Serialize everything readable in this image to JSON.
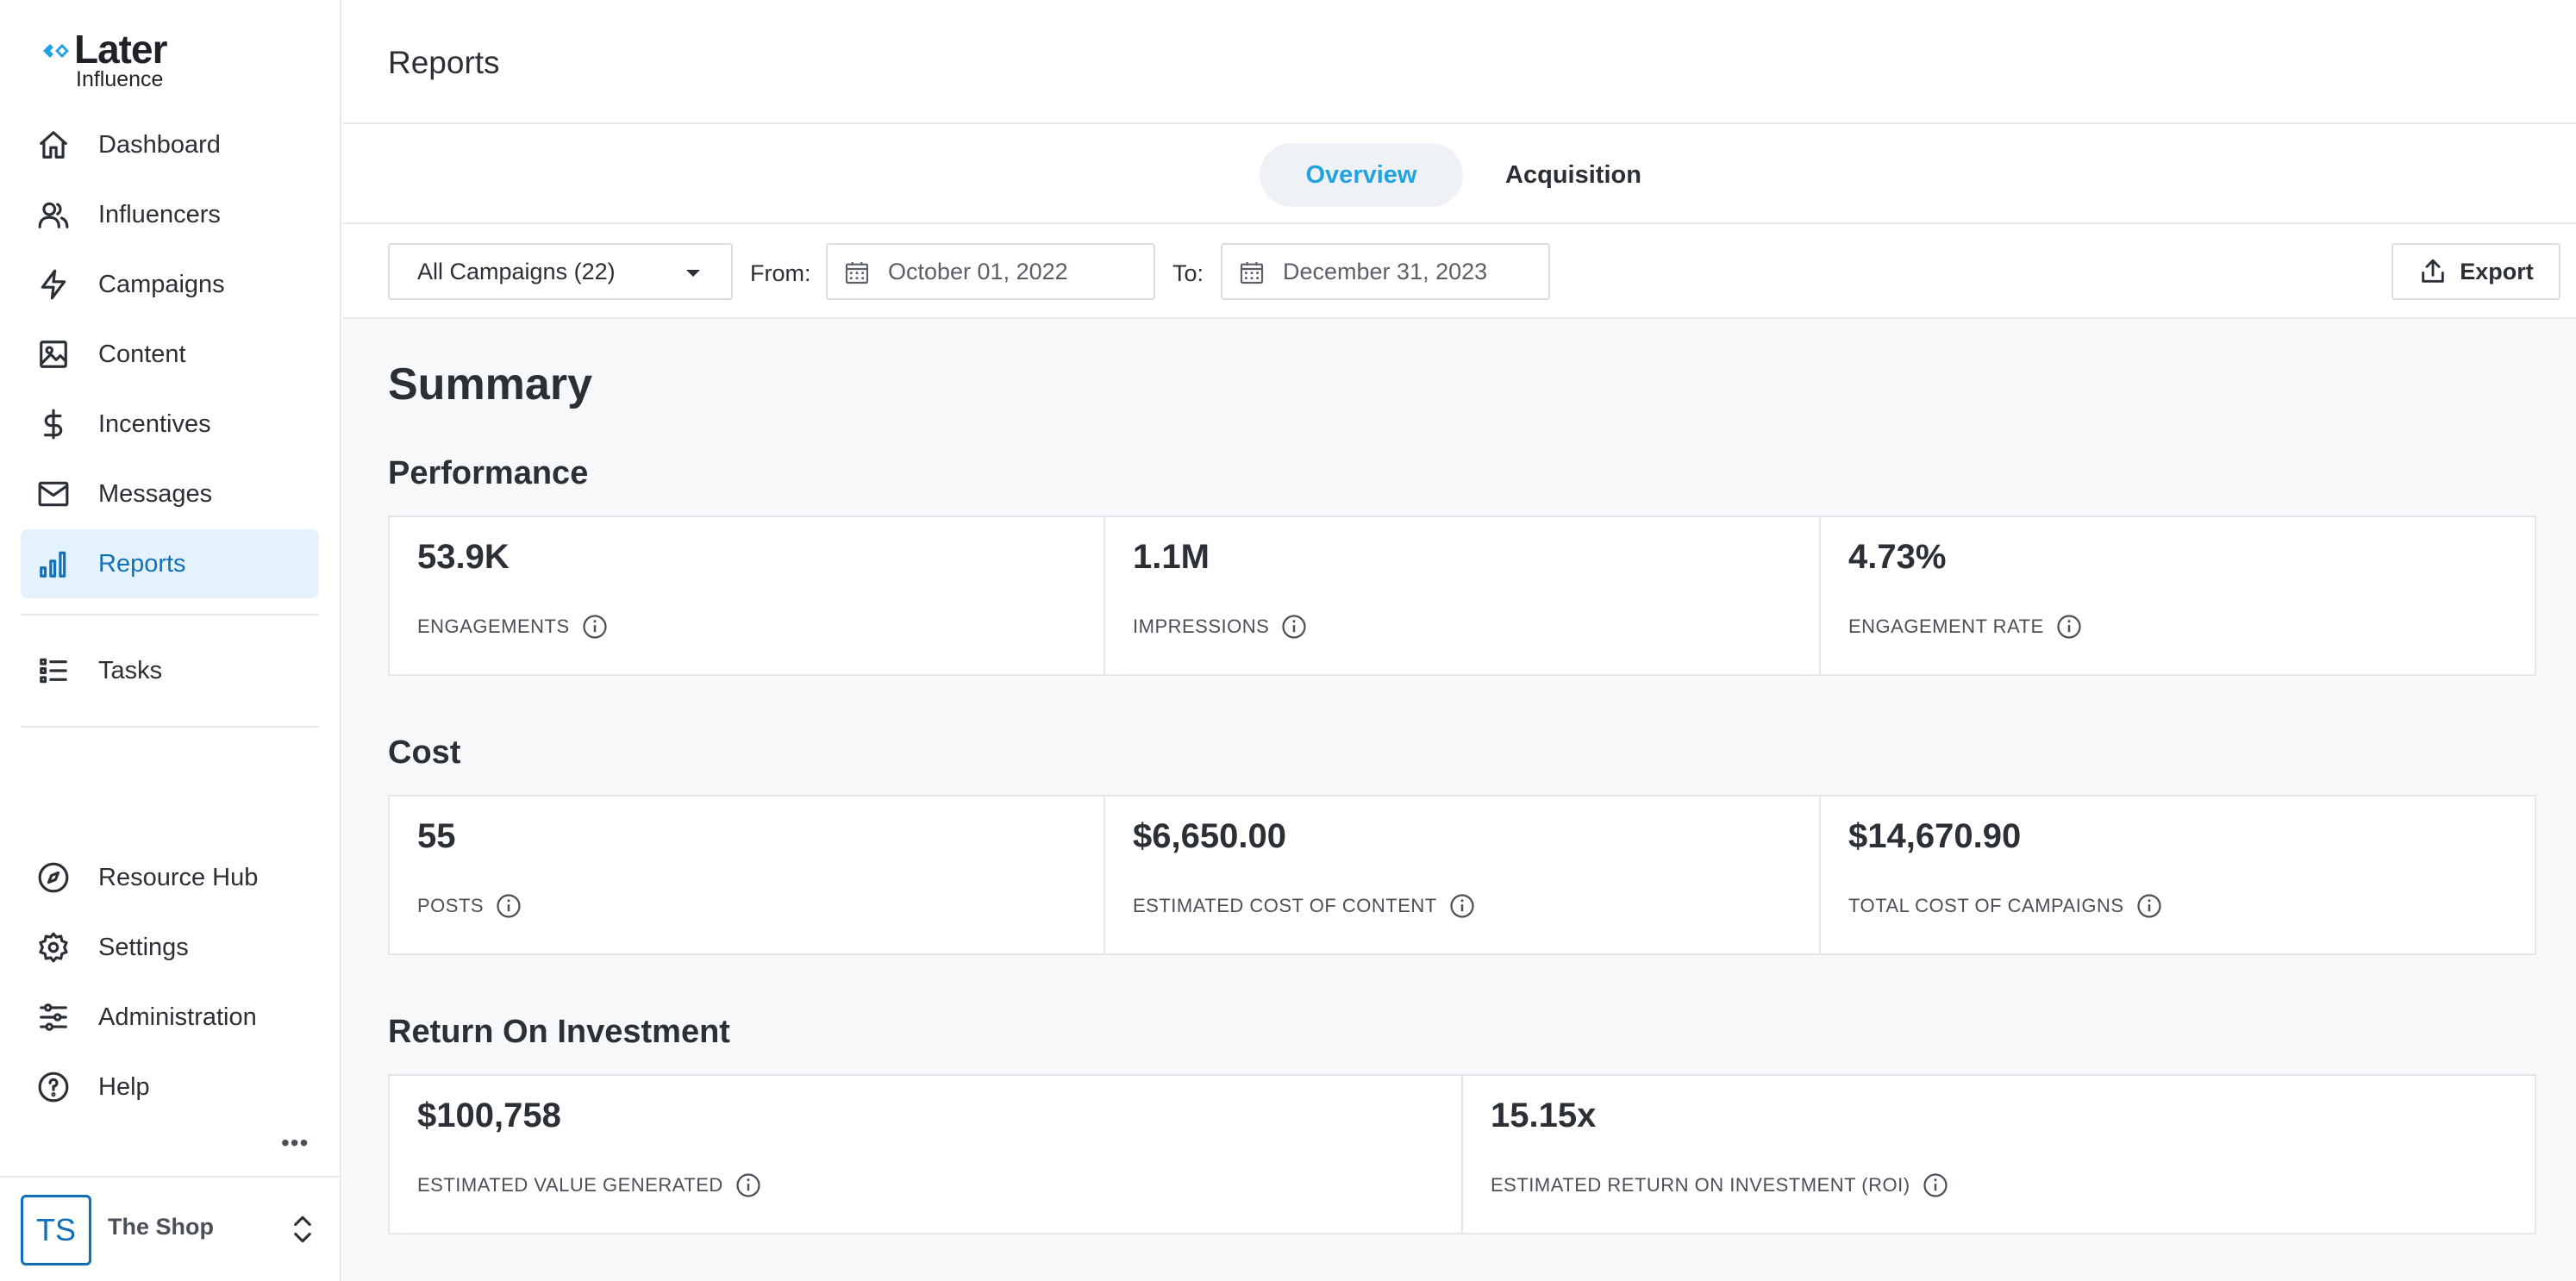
{
  "brand": {
    "name": "Later",
    "sub": "Influence",
    "accent": "#1270b8",
    "mark_color": "#23a2e0"
  },
  "nav": {
    "items": [
      {
        "label": "Dashboard",
        "icon": "home-icon"
      },
      {
        "label": "Influencers",
        "icon": "users-icon"
      },
      {
        "label": "Campaigns",
        "icon": "lightning-icon"
      },
      {
        "label": "Content",
        "icon": "image-icon"
      },
      {
        "label": "Incentives",
        "icon": "dollar-icon"
      },
      {
        "label": "Messages",
        "icon": "mail-icon"
      },
      {
        "label": "Reports",
        "icon": "bar-chart-icon",
        "active": true
      },
      {
        "label": "Tasks",
        "icon": "list-icon"
      }
    ],
    "bottom": [
      {
        "label": "Resource Hub",
        "icon": "compass-icon"
      },
      {
        "label": "Settings",
        "icon": "gear-icon"
      },
      {
        "label": "Administration",
        "icon": "sliders-icon"
      },
      {
        "label": "Help",
        "icon": "help-icon"
      }
    ],
    "more": "•••"
  },
  "shop": {
    "initials": "TS",
    "name": "The Shop"
  },
  "header": {
    "title": "Reports"
  },
  "tabs": [
    {
      "label": "Overview",
      "active": true
    },
    {
      "label": "Acquisition",
      "active": false
    }
  ],
  "filters": {
    "campaign": "All Campaigns (22)",
    "from_label": "From:",
    "from": "October 01, 2022",
    "to_label": "To:",
    "to": "December 31, 2023",
    "export": "Export"
  },
  "summary": {
    "title": "Summary",
    "sections": [
      {
        "title": "Performance",
        "cards": [
          {
            "value": "53.9K",
            "label": "ENGAGEMENTS"
          },
          {
            "value": "1.1M",
            "label": "IMPRESSIONS"
          },
          {
            "value": "4.73%",
            "label": "ENGAGEMENT RATE"
          }
        ]
      },
      {
        "title": "Cost",
        "cards": [
          {
            "value": "55",
            "label": "POSTS"
          },
          {
            "value": "$6,650.00",
            "label": "ESTIMATED COST OF CONTENT"
          },
          {
            "value": "$14,670.90",
            "label": "TOTAL COST OF CAMPAIGNS"
          }
        ]
      },
      {
        "title": "Return On Investment",
        "cards": [
          {
            "value": "$100,758",
            "label": "ESTIMATED VALUE GENERATED"
          },
          {
            "value": "15.15x",
            "label": "ESTIMATED RETURN ON INVESTMENT (ROI)"
          }
        ]
      }
    ]
  }
}
